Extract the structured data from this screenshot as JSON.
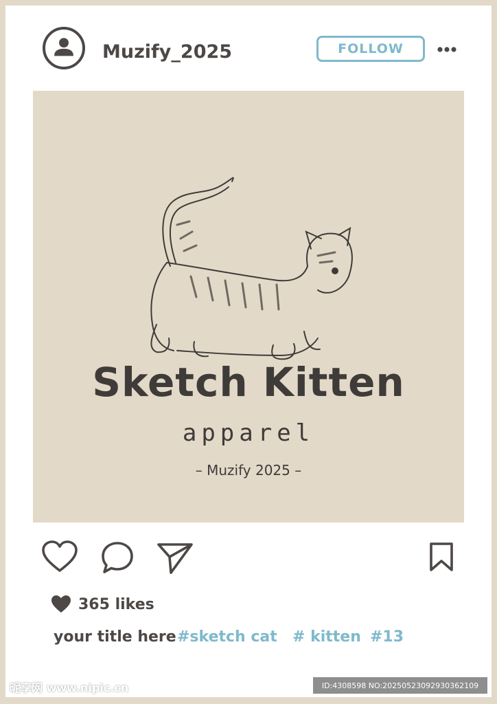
{
  "header": {
    "username": "Muzify_2025",
    "follow_label": "FOLLOW",
    "avatar_icon": "user-avatar-icon",
    "more_icon": "more-dots-icon"
  },
  "post_image": {
    "title": "Sketch Kitten",
    "subtitle": "apparel",
    "credit": "– Muzify 2025 –"
  },
  "actions": {
    "like_icon": "heart-outline-icon",
    "comment_icon": "comment-bubble-icon",
    "share_icon": "send-paper-plane-icon",
    "save_icon": "bookmark-icon"
  },
  "likes": {
    "text": "365 likes",
    "icon": "heart-filled-icon"
  },
  "caption": {
    "title": "your title here",
    "tags": [
      "#sketch cat",
      "# kitten",
      "#13"
    ]
  },
  "watermark": {
    "site": "昵享网 www.nipic.cn",
    "id_text": "ID:4308598 NO:20250523092930362109"
  },
  "colors": {
    "background": "#e2d9c8",
    "text_dark": "#4d4845",
    "accent": "#7fb9cc"
  }
}
